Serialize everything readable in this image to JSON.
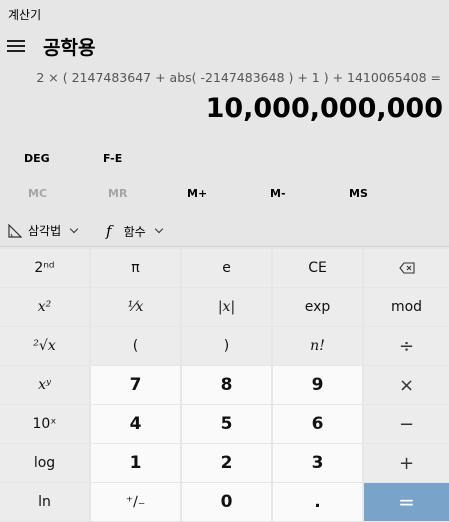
{
  "window": {
    "title": "계산기"
  },
  "header": {
    "mode_title": "공학용"
  },
  "display": {
    "expression": "2 × ( 2147483647 + abs( -2147483648 ) + 1 ) + 1410065408 =",
    "result": "10,000,000,000"
  },
  "angle_row": {
    "angle_unit": "DEG",
    "fe_label": "F-E"
  },
  "memory_row": {
    "mc": "MC",
    "mr": "MR",
    "m_plus": "M+",
    "m_minus": "M-",
    "ms": "MS"
  },
  "function_row": {
    "trig_label": "삼각법",
    "func_label": "함수"
  },
  "keys": {
    "second": "2ⁿᵈ",
    "pi": "π",
    "e": "e",
    "ce": "CE",
    "x_squared": "x²",
    "reciprocal": "¹⁄x",
    "abs": "|x|",
    "exp": "exp",
    "mod": "mod",
    "sqrt": "²√x",
    "lparen": "(",
    "rparen": ")",
    "factorial": "n!",
    "divide": "÷",
    "x_pow_y": "xʸ",
    "seven": "7",
    "eight": "8",
    "nine": "9",
    "multiply": "×",
    "ten_pow_x": "10ˣ",
    "four": "4",
    "five": "5",
    "six": "6",
    "minus": "−",
    "log": "log",
    "one": "1",
    "two": "2",
    "three": "3",
    "plus": "+",
    "ln": "ln",
    "negate": "⁺∕₋",
    "zero": "0",
    "decimal": ".",
    "equals": "="
  }
}
